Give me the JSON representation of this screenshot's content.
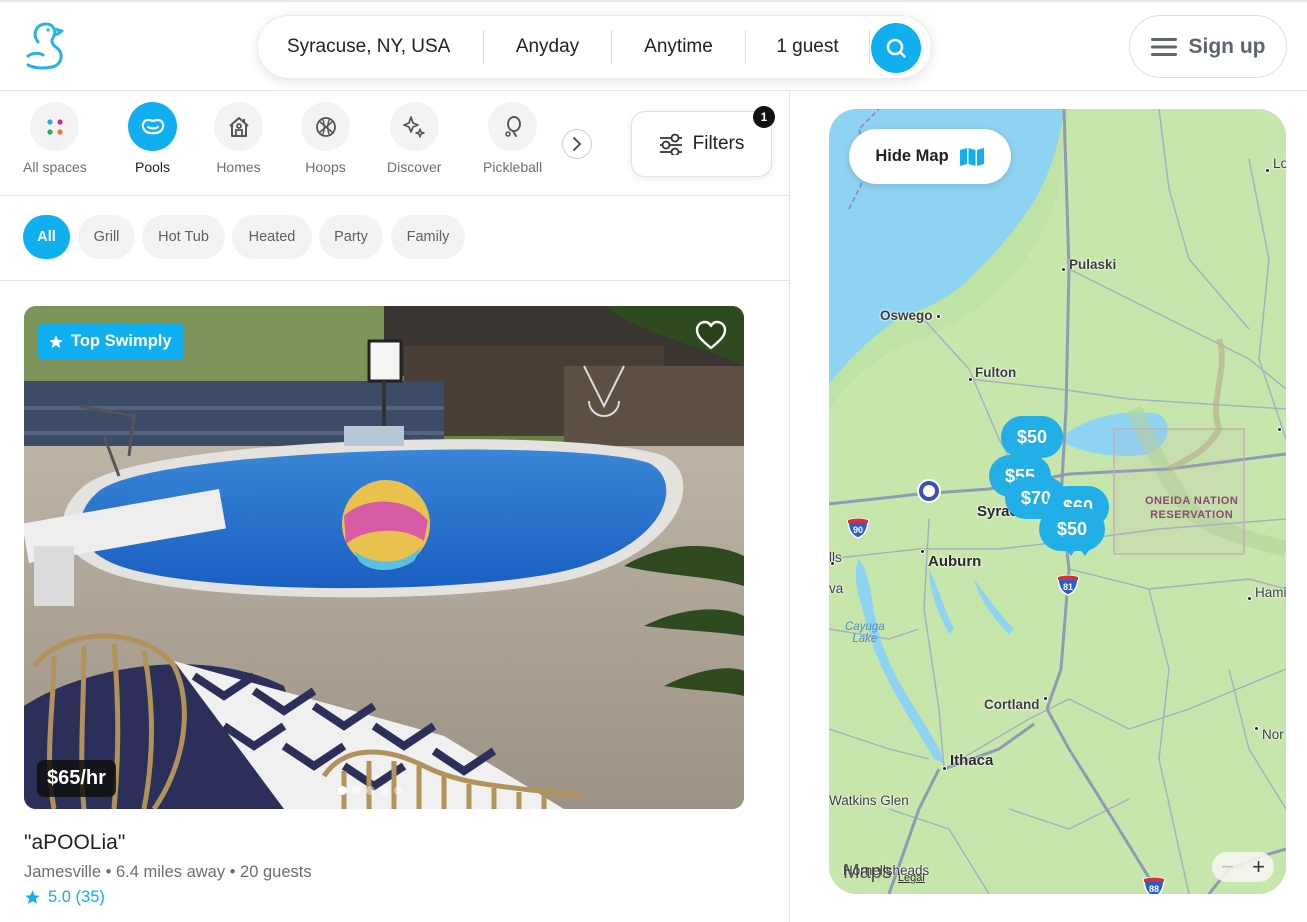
{
  "header": {
    "logo": "duck-logo",
    "search": {
      "location": "Syracuse, NY, USA",
      "date": "Anyday",
      "time": "Anytime",
      "guests": "1 guest"
    },
    "signup_label": "Sign up"
  },
  "categories": {
    "items": [
      {
        "label": "All spaces",
        "icon": "dots-grid-icon",
        "active": false
      },
      {
        "label": "Pools",
        "icon": "pool-icon",
        "active": true
      },
      {
        "label": "Homes",
        "icon": "house-icon",
        "active": false
      },
      {
        "label": "Hoops",
        "icon": "basketball-icon",
        "active": false
      },
      {
        "label": "Discover",
        "icon": "sparkle-icon",
        "active": false
      },
      {
        "label": "Pickleball",
        "icon": "paddle-icon",
        "active": false
      }
    ],
    "filters_label": "Filters",
    "filters_count": "1"
  },
  "chips": {
    "items": [
      {
        "label": "All",
        "active": true
      },
      {
        "label": "Grill",
        "active": false
      },
      {
        "label": "Hot Tub",
        "active": false
      },
      {
        "label": "Heated",
        "active": false
      },
      {
        "label": "Party",
        "active": false
      },
      {
        "label": "Family",
        "active": false
      }
    ]
  },
  "listing": {
    "badge": "Top Swimply",
    "price": "$65/hr",
    "title": "\"aPOOLia\"",
    "meta": "Jamesville • 6.4 miles away • 20 guests",
    "rating": "5.0 (35)",
    "photo_count": 5,
    "photo_index": 1
  },
  "map": {
    "hide_label": "Hide Map",
    "places": {
      "pulaski": "Pulaski",
      "oswego": "Oswego",
      "fulton": "Fulton",
      "syracuse": "Syracuse",
      "auburn": "Auburn",
      "cortland": "Cortland",
      "ithaca": "Ithaca",
      "watkins_glen": "Watkins Glen",
      "hornell": "Hornellsheads",
      "lowville": "Lo",
      "hamilton": "Hami",
      "norwich": "Nor",
      "seneca_falls": "lls",
      "geneva": "va"
    },
    "lake": "Cayuga\nLake",
    "reservation": "ONEIDA NATION\nRESERVATION",
    "pins": [
      "$50",
      "$55",
      "$70",
      "$60",
      "$50"
    ],
    "highways": [
      "90",
      "81",
      "88"
    ],
    "attribution": "Maps",
    "legal": "Legal",
    "zoom_in": "+",
    "zoom_out": "−",
    "colors": {
      "pin": "#22aee6",
      "land": "#bfe3a4",
      "water": "#8fd3f2"
    }
  }
}
